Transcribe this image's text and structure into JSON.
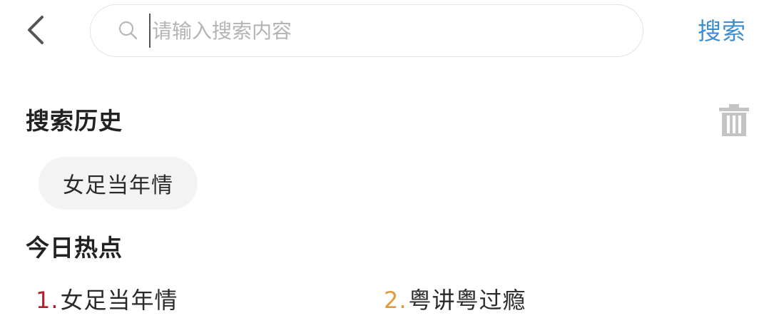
{
  "header": {
    "back_icon": "chevron-left-icon",
    "search": {
      "icon": "search-icon",
      "placeholder": "请输入搜索内容",
      "value": ""
    },
    "submit_label": "搜索",
    "submit_color": "#3d8fd1"
  },
  "history": {
    "title": "搜索历史",
    "clear_icon": "trash-icon",
    "items": [
      {
        "label": "女足当年情"
      }
    ]
  },
  "hot": {
    "title": "今日热点",
    "items": [
      {
        "rank": "1.",
        "label": "女足当年情",
        "rank_color": "#b3202a"
      },
      {
        "rank": "2.",
        "label": "粤讲粤过瘾",
        "rank_color": "#e39a3b"
      }
    ]
  }
}
